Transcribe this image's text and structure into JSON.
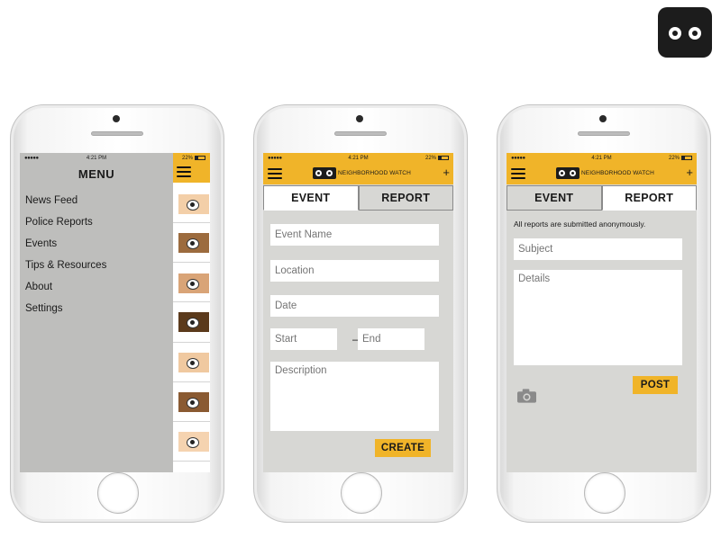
{
  "status_bar": {
    "carrier": "●●●●●",
    "wifi": "WiFi",
    "time": "4:21 PM",
    "bluetooth": "✱",
    "battery": "22%"
  },
  "brand": {
    "name": "NEIGHBORHOOD WATCH"
  },
  "phone1": {
    "menu_title": "MENU",
    "menu_items": [
      "News Feed",
      "Police Reports",
      "Events",
      "Tips & Resources",
      "About",
      "Settings"
    ],
    "thumb_colors": [
      "#f3cfa8",
      "#9c6b3e",
      "#d9a477",
      "#5b3a1c",
      "#f0c9a0",
      "#8a5a32",
      "#f5d3b0"
    ]
  },
  "phone2": {
    "tabs": [
      "EVENT",
      "REPORT"
    ],
    "active_tab": "EVENT",
    "placeholders": {
      "event_name": "Event Name",
      "location": "Location",
      "date": "Date",
      "start": "Start",
      "end": "End",
      "description": "Description"
    },
    "dash": "–",
    "create_label": "CREATE"
  },
  "phone3": {
    "tabs": [
      "EVENT",
      "REPORT"
    ],
    "active_tab": "REPORT",
    "note": "All reports are submitted anonymously.",
    "placeholders": {
      "subject": "Subject",
      "details": "Details"
    },
    "post_label": "POST"
  },
  "colors": {
    "accent": "#f0b429",
    "screen_bg": "#d7d7d4",
    "menu_bg": "#bebebc",
    "icon_bg": "#1c1c1c"
  }
}
